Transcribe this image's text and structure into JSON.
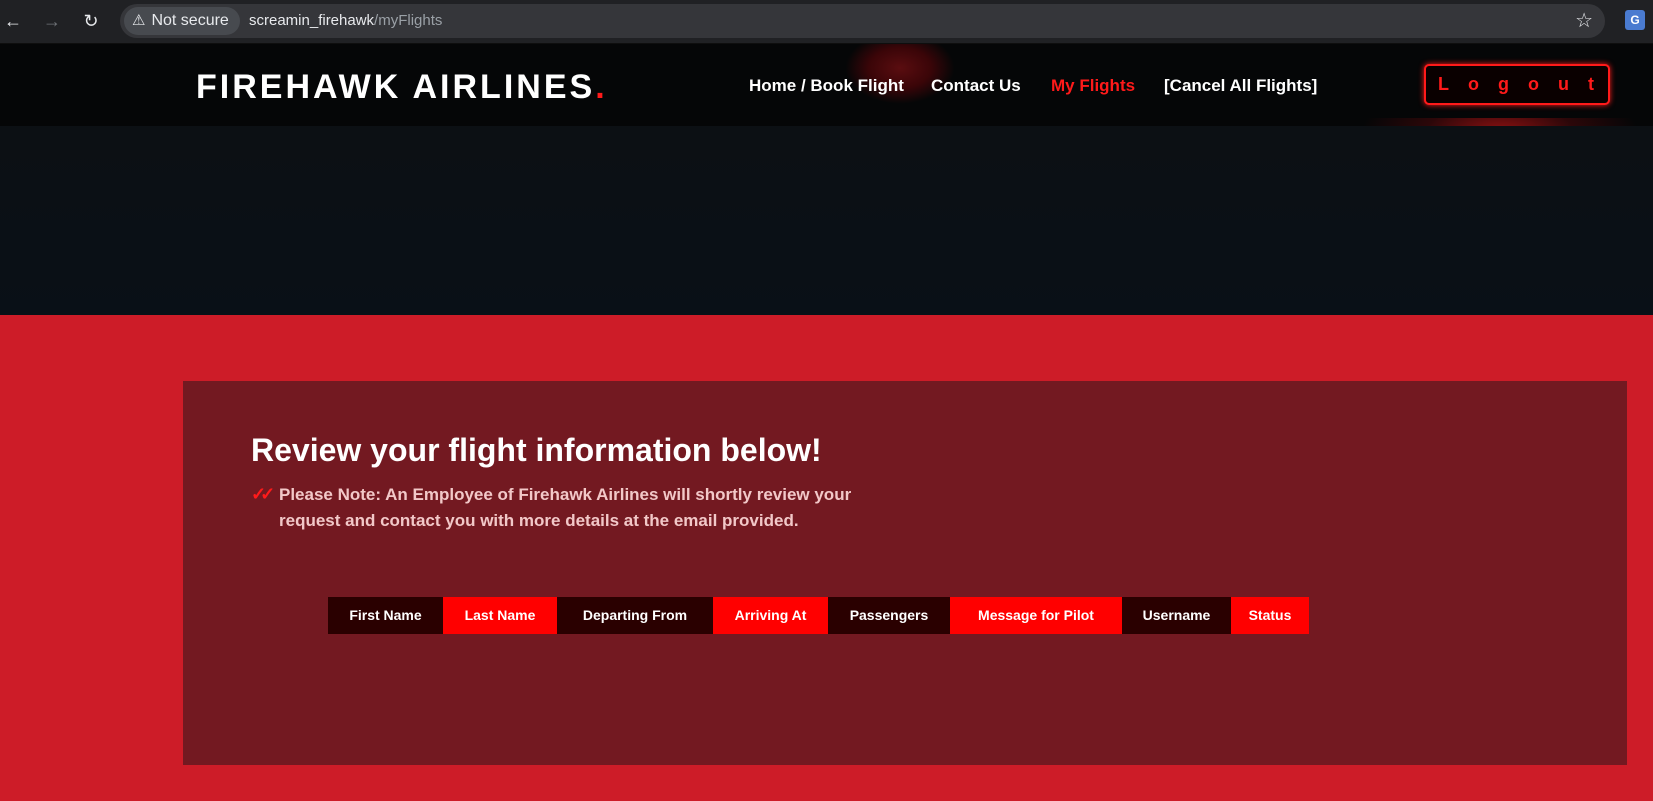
{
  "browser": {
    "security_label": "Not secure",
    "url_host": "screamin_firehawk",
    "url_path": "/myFlights"
  },
  "header": {
    "brand": "FIREHAWK AIRLINES",
    "brand_dot": ".",
    "nav": [
      {
        "label": "Home / Book Flight",
        "active": false
      },
      {
        "label": "Contact Us",
        "active": false
      },
      {
        "label": "My Flights",
        "active": true
      },
      {
        "label": "[Cancel All Flights]",
        "active": false
      }
    ],
    "logout_label": "Logout"
  },
  "main": {
    "heading": "Review your flight information below!",
    "note": "Please Note: An Employee of Firehawk Airlines will shortly review your request and contact you with more details at the email provided.",
    "table": {
      "columns": [
        "First Name",
        "Last Name",
        "Departing From",
        "Arriving At",
        "Passengers",
        "Message for Pilot",
        "Username",
        "Status"
      ],
      "rows": []
    }
  },
  "colors": {
    "accent": "#ff1a1a",
    "page_red": "#cd1c28",
    "card": "#731921",
    "header_bg": "#050607"
  }
}
